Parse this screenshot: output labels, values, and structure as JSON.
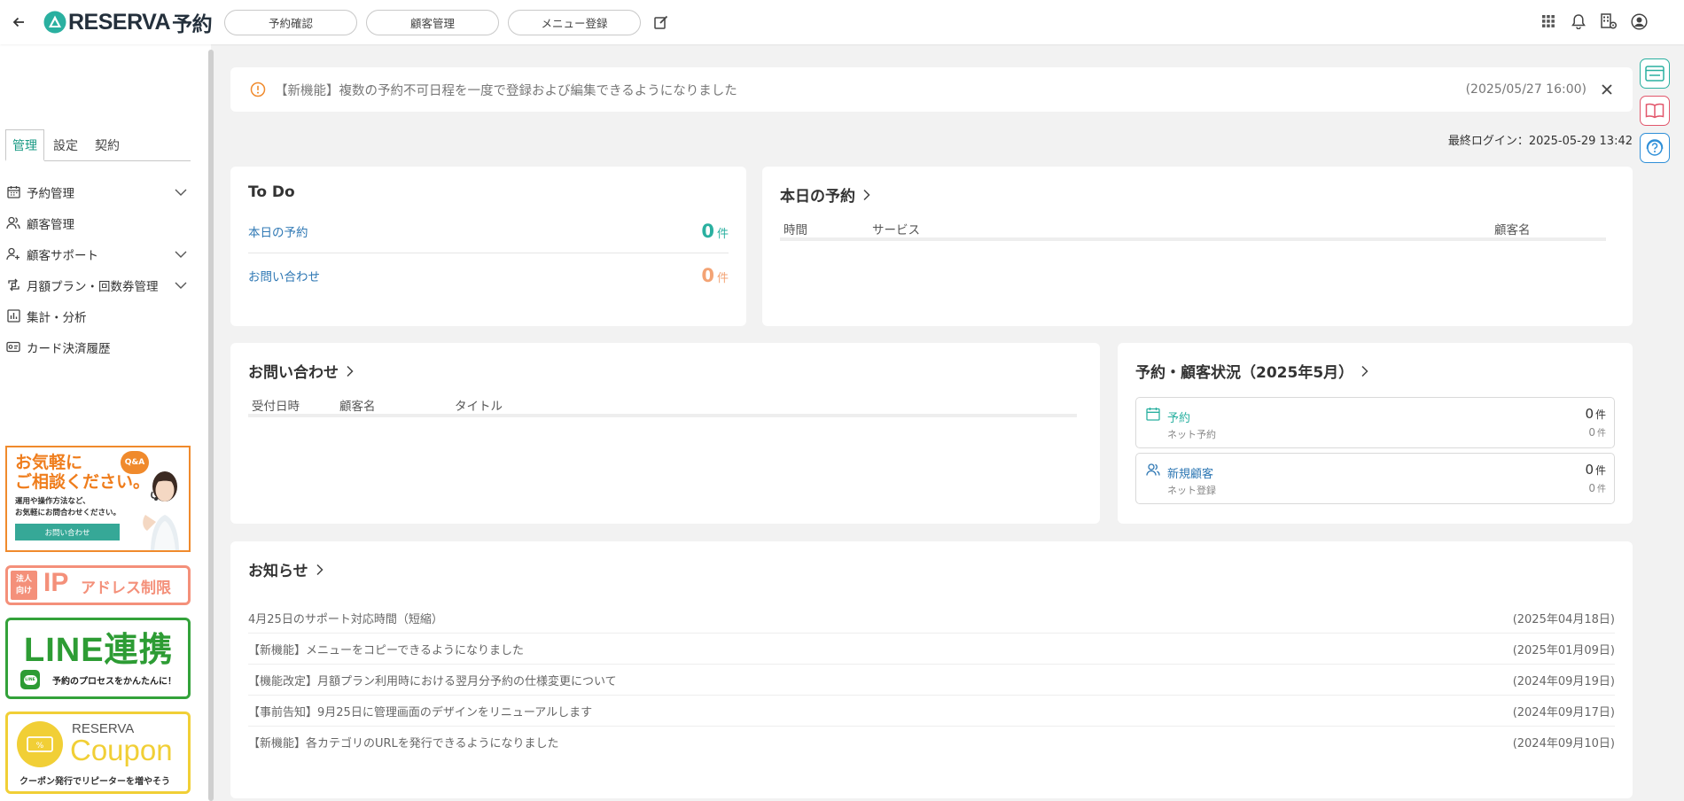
{
  "header": {
    "logo_text": "RESERVA",
    "logo_suffix": "予約",
    "nav": [
      "予約確認",
      "顧客管理",
      "メニュー登録"
    ]
  },
  "sidebar": {
    "tabs": [
      "管理",
      "設定",
      "契約"
    ],
    "items": [
      {
        "label": "予約管理",
        "icon": "calendar-icon"
      },
      {
        "label": "顧客管理",
        "icon": "users-icon"
      },
      {
        "label": "顧客サポート",
        "icon": "user-support-icon"
      },
      {
        "label": "月額プラン・回数券管理",
        "icon": "repeat-icon"
      },
      {
        "label": "集計・分析",
        "icon": "bar-chart-icon"
      },
      {
        "label": "カード決済履歴",
        "icon": "card-icon"
      }
    ],
    "banners": {
      "consult": {
        "line1": "お気軽に",
        "line2": "ご相談ください。",
        "qa": "Q&A",
        "body1": "運用や操作方法など、",
        "body2": "お気軽にお問合わせください。",
        "button": "お問い合わせ"
      },
      "ip": {
        "tag1": "法人",
        "tag2": "向け",
        "ip": "IP",
        "text": "アドレス制限"
      },
      "line": {
        "title": "LINE連携",
        "icon_text": "LINE",
        "sub": "予約のプロセスをかんたんに！"
      },
      "coupon": {
        "brand": "RESERVA",
        "title": "Coupon",
        "sub": "クーポン発行でリピーターを増やそう"
      }
    }
  },
  "notice": {
    "text": "【新機能】複数の予約不可日程を一度で登録および編集できるようになりました",
    "date": "(2025/05/27 16:00)"
  },
  "last_login": "最終ログイン：2025-05-29 13:42",
  "todo": {
    "title": "To Do",
    "rows": [
      {
        "label": "本日の予約",
        "count": "0",
        "unit": "件"
      },
      {
        "label": "お問い合わせ",
        "count": "0",
        "unit": "件"
      }
    ]
  },
  "today": {
    "title": "本日の予約",
    "columns": [
      "時間",
      "サービス",
      "顧客名"
    ]
  },
  "inquiries": {
    "title": "お問い合わせ",
    "columns": [
      "受付日時",
      "顧客名",
      "タイトル"
    ]
  },
  "status": {
    "title": "予約・顧客状況（2025年5月）",
    "boxes": [
      {
        "label": "予約",
        "sub": "ネット予約",
        "count": "0",
        "sub_count": "0",
        "unit": "件"
      },
      {
        "label": "新規顧客",
        "sub": "ネット登録",
        "count": "0",
        "sub_count": "0",
        "unit": "件"
      }
    ]
  },
  "news": {
    "title": "お知らせ",
    "items": [
      {
        "title": "4月25日のサポート対応時間（短縮）",
        "date": "(2025年04月18日)"
      },
      {
        "title": "【新機能】メニューをコピーできるようになりました",
        "date": "(2025年01月09日)"
      },
      {
        "title": "【機能改定】月額プラン利用時における翌月分予約の仕様変更について",
        "date": "(2024年09月19日)"
      },
      {
        "title": "【事前告知】9月25日に管理画面のデザインをリニューアルします",
        "date": "(2024年09月17日)"
      },
      {
        "title": "【新機能】各カテゴリのURLを発行できるようになりました",
        "date": "(2024年09月10日)"
      }
    ]
  },
  "colors": {
    "brand": "#24303c",
    "accent": "#2ab0a0",
    "link": "#2f78b4",
    "orange": "#f3a374"
  }
}
